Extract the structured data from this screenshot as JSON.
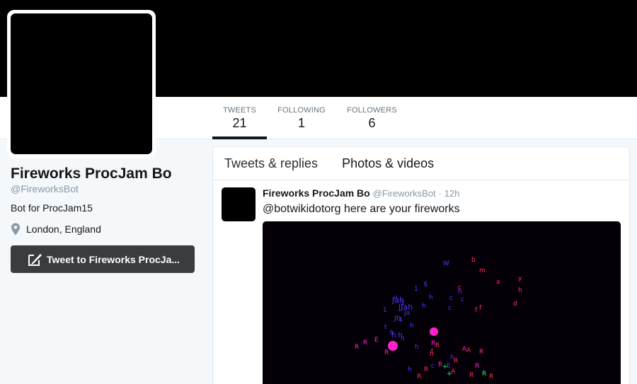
{
  "profile": {
    "name": "Fireworks ProcJam Bo",
    "handle": "@FireworksBot",
    "bio": "Bot for ProcJam15",
    "location": "London, England",
    "tweet_to_label": "Tweet to Fireworks ProcJa..."
  },
  "stats": {
    "tweets": {
      "label": "TWEETS",
      "value": "21"
    },
    "following": {
      "label": "FOLLOWING",
      "value": "1"
    },
    "followers": {
      "label": "FOLLOWERS",
      "value": "6"
    }
  },
  "timeline": {
    "tabs": [
      {
        "label": "Tweets & replies"
      },
      {
        "label": "Photos & videos"
      }
    ],
    "tweets": [
      {
        "author": "Fireworks ProcJam Bo",
        "handle": "@FireworksBot",
        "separator": "·",
        "time": "12h",
        "mention": "@botwikidotorg",
        "text": " here are your fireworks"
      }
    ]
  },
  "colors": {
    "banner": "#000000",
    "button": "#3a3c3e",
    "muted": "#8899a6",
    "firework_pink": "#ff22cc",
    "firework_blue": "#5533ff",
    "firework_red": "#ff3355",
    "firework_green": "#22ff66"
  },
  "icons": {
    "location": "map-pin-icon",
    "tweet_to": "compose-icon"
  }
}
